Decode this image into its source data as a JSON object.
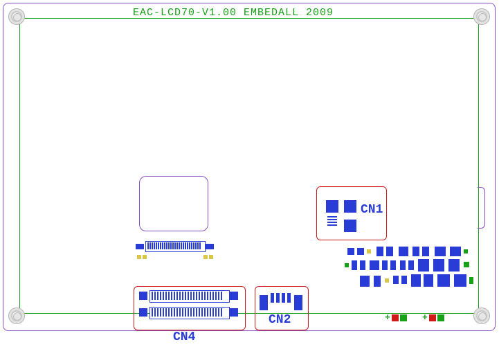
{
  "board": {
    "title": "EAC-LCD70-V1.00  EMBEDALL 2009"
  },
  "connectors": {
    "cn1": {
      "label": "CN1"
    },
    "cn2": {
      "label": "CN2"
    },
    "cn4": {
      "label": "CN4"
    }
  },
  "polarity": {
    "plus1": "+",
    "plus2": "+"
  }
}
